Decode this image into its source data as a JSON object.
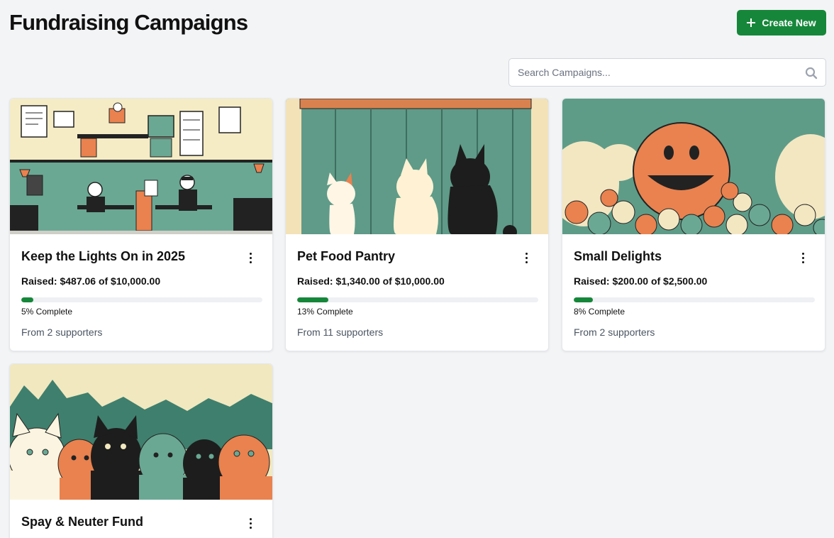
{
  "header": {
    "title": "Fundraising Campaigns",
    "create_label": "Create New"
  },
  "search": {
    "placeholder": "Search Campaigns..."
  },
  "colors": {
    "accent": "#16873a",
    "teal": "#6aa894",
    "orange": "#e9824f",
    "cream": "#f5ecc6"
  },
  "campaigns": [
    {
      "title": "Keep the Lights On in 2025",
      "raised": "Raised: $487.06 of $10,000.00",
      "progress": 0.05,
      "percent": "5% Complete",
      "supporters": "From 2 supporters",
      "image": "office-illustration"
    },
    {
      "title": "Pet Food Pantry",
      "raised": "Raised: $1,340.00 of $10,000.00",
      "progress": 0.13,
      "percent": "13% Complete",
      "supporters": "From 11 supporters",
      "image": "cats-at-window-illustration"
    },
    {
      "title": "Small Delights",
      "raised": "Raised: $200.00 of $2,500.00",
      "progress": 0.08,
      "percent": "8% Complete",
      "supporters": "From 2 supporters",
      "image": "smiling-faces-illustration"
    },
    {
      "title": "Spay & Neuter Fund",
      "image": "crowd-of-cats-illustration"
    }
  ]
}
